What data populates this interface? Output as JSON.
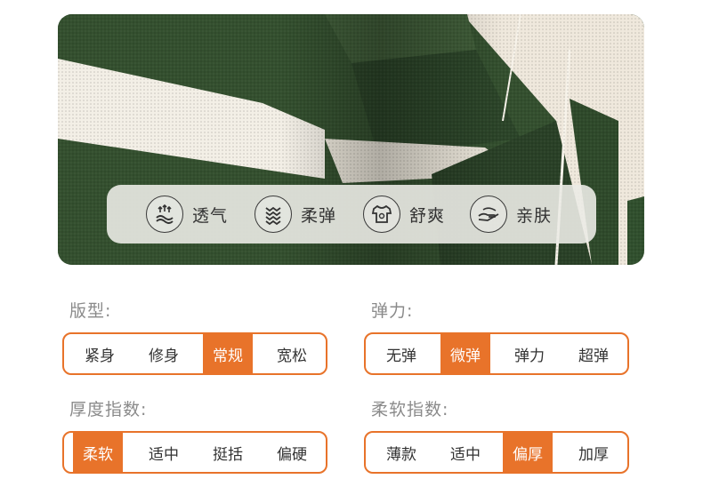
{
  "features": [
    {
      "icon": "airflow-icon",
      "label": "透气"
    },
    {
      "icon": "stretch-wave-icon",
      "label": "柔弹"
    },
    {
      "icon": "tshirt-icon",
      "label": "舒爽"
    },
    {
      "icon": "skin-hand-icon",
      "label": "亲肤"
    }
  ],
  "groups": [
    {
      "title": "版型:",
      "options": [
        "紧身",
        "修身",
        "常规",
        "宽松"
      ],
      "selected_index": 2
    },
    {
      "title": "弹力:",
      "options": [
        "无弹",
        "微弹",
        "弹力",
        "超弹"
      ],
      "selected_index": 1
    },
    {
      "title": "厚度指数:",
      "options": [
        "柔软",
        "适中",
        "挺括",
        "偏硬"
      ],
      "selected_index": 0
    },
    {
      "title": "柔软指数:",
      "options": [
        "薄款",
        "适中",
        "偏厚",
        "加厚"
      ],
      "selected_index": 2
    }
  ],
  "colors": {
    "accent": "#e8732a",
    "fabric_green": "#2f4a2e",
    "fabric_cream": "#f1ece2"
  }
}
